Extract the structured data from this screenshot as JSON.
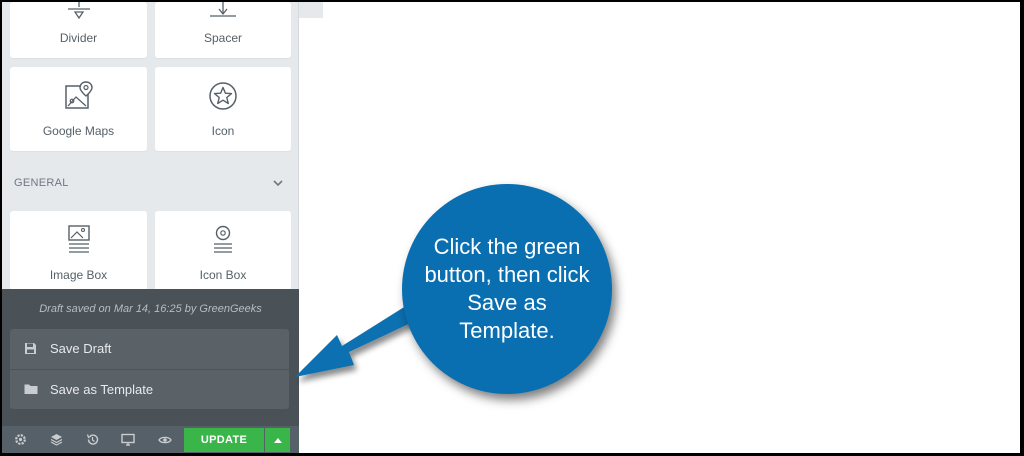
{
  "widgets": [
    {
      "label": "Divider",
      "icon": "divider-icon"
    },
    {
      "label": "Spacer",
      "icon": "spacer-icon"
    },
    {
      "label": "Google Maps",
      "icon": "map-icon"
    },
    {
      "label": "Icon",
      "icon": "star-icon"
    },
    {
      "label": "Image Box",
      "icon": "image-box-icon"
    },
    {
      "label": "Icon Box",
      "icon": "icon-box-icon"
    }
  ],
  "section": {
    "title": "GENERAL"
  },
  "save_panel": {
    "draft_note": "Draft saved on Mar 14, 16:25 by GreenGeeks",
    "save_draft": "Save Draft",
    "save_template": "Save as Template"
  },
  "toolbar": {
    "update_label": "UPDATE",
    "icons": [
      "gear-icon",
      "layers-icon",
      "history-icon",
      "responsive-icon",
      "preview-icon"
    ]
  },
  "callout": {
    "text": "Click the green button, then click Save as Template."
  },
  "colors": {
    "update_green": "#39b54a",
    "callout_blue": "#0a6fb0",
    "panel_dark": "#4a5157"
  }
}
